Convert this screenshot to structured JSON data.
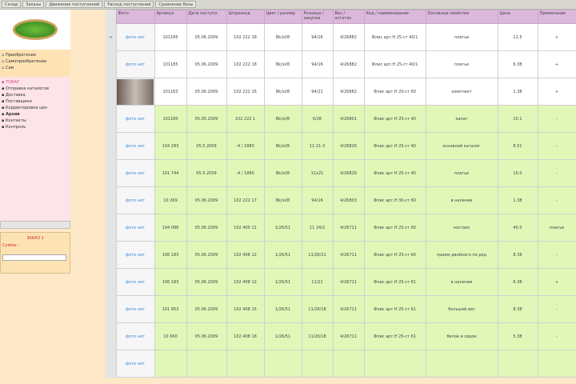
{
  "topbar": {
    "tabs": [
      "Склад",
      "Заказы",
      "Движение поступлений",
      "Расход поступлений",
      "Сравнение базы"
    ]
  },
  "sidebar": {
    "menu1": [
      "Приобретение",
      "Самоприобретение",
      "Сам"
    ],
    "menu2": [
      {
        "label": "ТОВАР"
      },
      {
        "label": "Отправка каталогов"
      },
      {
        "label": "Доставка"
      },
      {
        "label": "Поставщики"
      },
      {
        "label": "Корректировка цен"
      },
      {
        "label": "Архив"
      },
      {
        "label": "Контакты"
      },
      {
        "label": "Контроль"
      }
    ],
    "panel": {
      "title": "ЗАКАЗ 1",
      "subtitle": "Сумма: -",
      "input_value": ""
    }
  },
  "table": {
    "headers": [
      "Фото",
      "Артикул",
      "Дата поступл.",
      "Штрихкод",
      "Цвет / размер",
      "Розница / закупка",
      "Вес / остаток",
      "Код / наименование",
      "Основные свойства",
      "Цена",
      "Примечание"
    ],
    "photo_link": "фото нет",
    "rows": [
      {
        "green": false,
        "photo": "link",
        "cells": [
          "101185",
          "05.06.2009",
          "102 222 18",
          "Bk/xl/8",
          "94/16",
          "4/26882",
          "Флис арт.Н 25-ст 40/1",
          "платье",
          "12.5",
          "+"
        ]
      },
      {
        "green": false,
        "photo": "link",
        "cells": [
          "101185",
          "05.06.2009",
          "102 222 18",
          "Bk/xl/8",
          "94/16",
          "4/26882",
          "Флис арт.Н 25-ст 40/1",
          "платье",
          "6.38",
          "+"
        ]
      },
      {
        "green": false,
        "photo": "image",
        "cells": [
          "101183",
          "05.06.2009",
          "102 222 16",
          "Bk/xl/8",
          "94/21",
          "4/26882",
          "Флис арт.Н 20-ст 60",
          "комплект",
          "1.38",
          "+"
        ]
      },
      {
        "green": true,
        "photo": "link",
        "cells": [
          "101180",
          "05.05.2009",
          "102 222 1",
          "Bk/xl/8",
          "6/26",
          "4/26801",
          "Флис арт.Н 25-ст 40",
          "халат",
          "10.1",
          "-"
        ]
      },
      {
        "green": true,
        "photo": "link",
        "cells": [
          "104 283",
          "05.5.2009",
          "-4 / 1880",
          "Bk/xl/8",
          "11-21-3",
          "4/26826",
          "Флис арт.Н 25-ст 40",
          "основной каталог",
          "8.51",
          "-"
        ]
      },
      {
        "green": true,
        "photo": "link",
        "cells": [
          "101 744",
          "05.5.2009",
          "-4 / 1880",
          "Bk/xl/8",
          "11x21",
          "4/26826",
          "Флис арт.Н 25-ст 40",
          "платье",
          "10.0",
          "-"
        ]
      },
      {
        "green": true,
        "photo": "link",
        "cells": [
          "10 269",
          "05.06.2009",
          "102 222 17",
          "Bk/xl/8",
          "94/16",
          "4/26803",
          "Флис арт.Н 30-ст 60",
          "в наличии",
          "1.38",
          "-"
        ]
      },
      {
        "green": true,
        "photo": "link",
        "cells": [
          "104 088",
          "05.06.2009",
          "102 400 11",
          "1/26/51",
          "11 24/2",
          "4/26711",
          "Флис арт.Н 25-ст 60",
          "костюм",
          "40.0",
          "платье"
        ]
      },
      {
        "green": true,
        "photo": "link",
        "cells": [
          "106 183",
          "05.06.2009",
          "102 408 12",
          "1/26/51",
          "11/26/21",
          "4/26711",
          "Флис арт.Н 25-ст 60",
          "прием двойного по ред",
          "8.38",
          "-"
        ]
      },
      {
        "green": true,
        "photo": "link",
        "cells": [
          "106 183",
          "05.06.2009",
          "102 408 12",
          "1/26/51",
          "11/21",
          "4/26711",
          "Флис арт.Н 25-ст 61",
          "в наличии",
          "6.38",
          "+"
        ]
      },
      {
        "green": true,
        "photo": "link",
        "cells": [
          "101 953",
          "05.06.2009",
          "102 408 15",
          "1/26/51",
          "11/26/18",
          "4/26711",
          "Флис арт.Н 25-ст 61",
          "большой вес",
          "8.38",
          "-"
        ]
      },
      {
        "green": true,
        "photo": "link",
        "cells": [
          "10 660",
          "05.06.2009",
          "102 408 18",
          "1/26/51",
          "11/26/18",
          "4/26711",
          "Флис арт.Н 25-ст 61",
          "белое и серое",
          "5.38",
          "-"
        ]
      },
      {
        "green": true,
        "photo": "link",
        "cells": [
          "",
          "",
          "",
          "",
          "",
          "",
          "",
          "",
          "",
          ""
        ]
      }
    ]
  }
}
